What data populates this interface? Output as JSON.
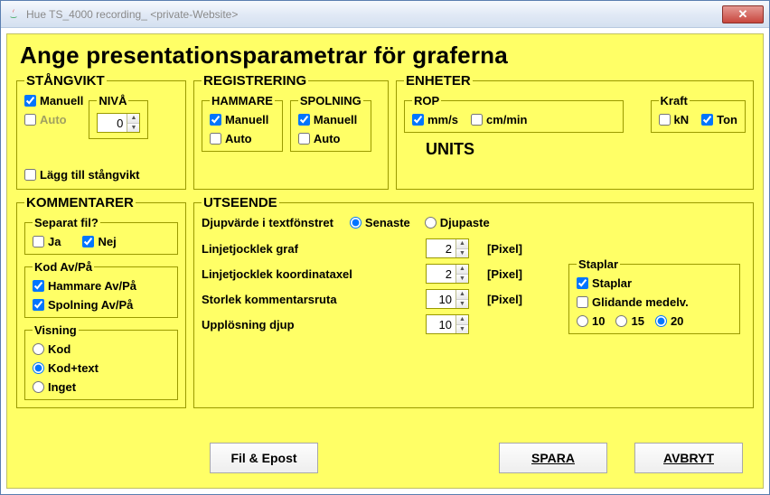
{
  "window": {
    "title": "Hue TS_4000 recording_ <private-Website>",
    "closeGlyph": "✕"
  },
  "main_title": "Ange presentationsparametrar för graferna",
  "stangvikt": {
    "legend": "STÅNGVIKT",
    "manuell": "Manuell",
    "auto": "Auto",
    "niva_legend": "NIVÅ",
    "niva_value": "0",
    "lagg_till": "Lägg till stångvikt",
    "manuell_checked": true,
    "auto_checked": false,
    "lagg_checked": false
  },
  "registrering": {
    "legend": "REGISTRERING",
    "hammare": {
      "legend": "HAMMARE",
      "manuell": "Manuell",
      "auto": "Auto",
      "manuell_checked": true,
      "auto_checked": false
    },
    "spolning": {
      "legend": "SPOLNING",
      "manuell": "Manuell",
      "auto": "Auto",
      "manuell_checked": true,
      "auto_checked": false
    }
  },
  "enheter": {
    "legend": "ENHETER",
    "rop": {
      "legend": "ROP",
      "mms": "mm/s",
      "cmmin": "cm/min",
      "mms_checked": true,
      "cmmin_checked": false
    },
    "kraft": {
      "legend": "Kraft",
      "kn": "kN",
      "ton": "Ton",
      "kn_checked": false,
      "ton_checked": true
    },
    "units_label": "UNITS"
  },
  "kommentarer": {
    "legend": "KOMMENTARER",
    "separat": {
      "legend": "Separat fil?",
      "ja": "Ja",
      "nej": "Nej",
      "ja_checked": false,
      "nej_checked": true
    },
    "kod": {
      "legend": "Kod Av/På",
      "hammare": "Hammare Av/På",
      "spolning": "Spolning Av/På",
      "hammare_checked": true,
      "spolning_checked": true
    },
    "visning": {
      "legend": "Visning",
      "kod": "Kod",
      "kodtext": "Kod+text",
      "inget": "Inget",
      "selected": "kodtext"
    }
  },
  "utseende": {
    "legend": "UTSEENDE",
    "djup_label": "Djupvärde i textfönstret",
    "senaste": "Senaste",
    "djupaste": "Djupaste",
    "djup_selected": "senaste",
    "rows": {
      "linje_graf": {
        "label": "Linjetjocklek graf",
        "value": "2",
        "unit": "[Pixel]"
      },
      "linje_axel": {
        "label": "Linjetjocklek koordinataxel",
        "value": "2",
        "unit": "[Pixel]"
      },
      "storlek": {
        "label": "Storlek kommentarsruta",
        "value": "10",
        "unit": "[Pixel]"
      },
      "upplosning": {
        "label": "Upplösning djup",
        "value": "10",
        "unit": ""
      }
    },
    "staplar": {
      "legend": "Staplar",
      "staplar": "Staplar",
      "glidande": "Glidande medelv.",
      "staplar_checked": true,
      "glidande_checked": false,
      "r10": "10",
      "r15": "15",
      "r20": "20",
      "selected": "20"
    }
  },
  "buttons": {
    "fil_epost": "Fil & Epost",
    "spara": "SPARA",
    "avbryt": "AVBRYT"
  }
}
